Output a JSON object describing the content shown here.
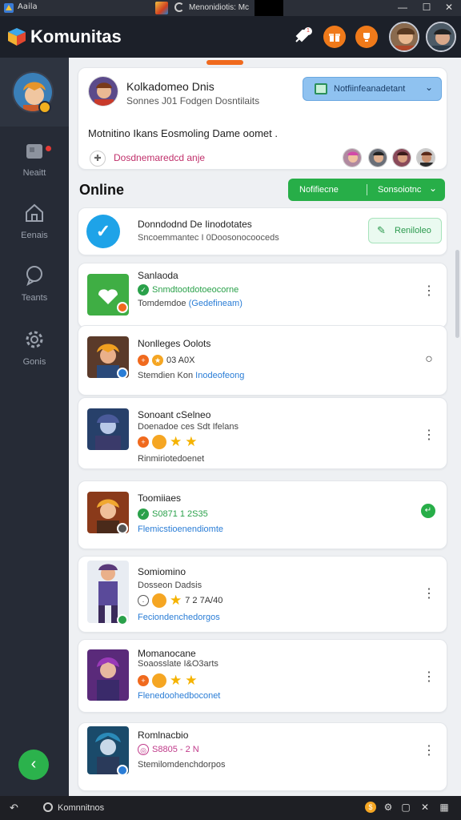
{
  "titlebar": {
    "app_label": "Aaila",
    "window_title": "Menonidiotis: Mc",
    "controls": [
      "—",
      "☐",
      "✕"
    ]
  },
  "header": {
    "brand": "Komunitas",
    "icons": [
      "rocket-icon",
      "gift-icon",
      "trophy-icon"
    ],
    "notification_badge": "1"
  },
  "sidebar": {
    "items": [
      {
        "label": "Neaitt",
        "icon": "inbox-icon"
      },
      {
        "label": "Eenais",
        "icon": "home-icon"
      },
      {
        "label": "Teants",
        "icon": "chat-icon"
      },
      {
        "label": "Gonis",
        "icon": "gear-icon"
      }
    ],
    "fab_icon": "‹"
  },
  "post": {
    "name": "Kolkadomeo Dnis",
    "subtitle": "Sonnes J01 Fodgen Dosntilaits",
    "notif_button": "Notfiinfeanadetant",
    "text": "Motnitino Ikans Eosmoling Dame oomet .",
    "link": "Dosdnemaredcd anje"
  },
  "online": {
    "heading": "Online",
    "btn_left": "Nofifiecne",
    "btn_right": "Sonsoiotnc"
  },
  "feature": {
    "title": "Donndodnd De Iinodotates",
    "subtitle": "Sncoemmantec I 0Doosonocooceds",
    "button": "Reniloleo"
  },
  "games": [
    {
      "title": "Sanlaoda",
      "meta": "Snmdtootdotoeocorne",
      "desc": "Tomdemdoe",
      "desc_link": "(Gedefineam)",
      "action": "⋮",
      "meta_color": "#2aa14a"
    },
    {
      "title": "Nonlleges Oolots",
      "meta": "03 A0X",
      "desc": "Stemdien Kon",
      "desc_link": "Inodeofeong",
      "action": "○",
      "meta_color": "#333"
    },
    {
      "title": "Sonoant cSelneo",
      "meta2": "Doenadoe ces Sdt Ifelans",
      "desc": "Rinmiriotedoenet",
      "action": "⋮"
    },
    {
      "title": "Toomiiaes",
      "meta": "S0871 1 2S35",
      "desc": "Flemicstioenendiomte",
      "action": "↵",
      "meta_color": "#2aa14a"
    },
    {
      "title": "Somiomino",
      "meta2": "Dosseon Dadsis",
      "meta": "7 2 7A/40",
      "desc": "Feciondenchedorgos",
      "action": "⋮"
    },
    {
      "title": "Momanocane",
      "meta2": "Soaosslate I&O3arts",
      "desc": "Flenedoohedboconet",
      "action": "⋮"
    },
    {
      "title": "Romlnacbio",
      "meta": "S8805 - 2 N",
      "desc": "Stemilomdenchdorpos",
      "action": "⋮",
      "meta_color": "#c03a8a"
    }
  ],
  "taskbar": {
    "label": "Komnnitnos"
  },
  "colors": {
    "accent_green": "#27ae48",
    "accent_blue": "#1ea3e8",
    "orange": "#f06a1e"
  }
}
